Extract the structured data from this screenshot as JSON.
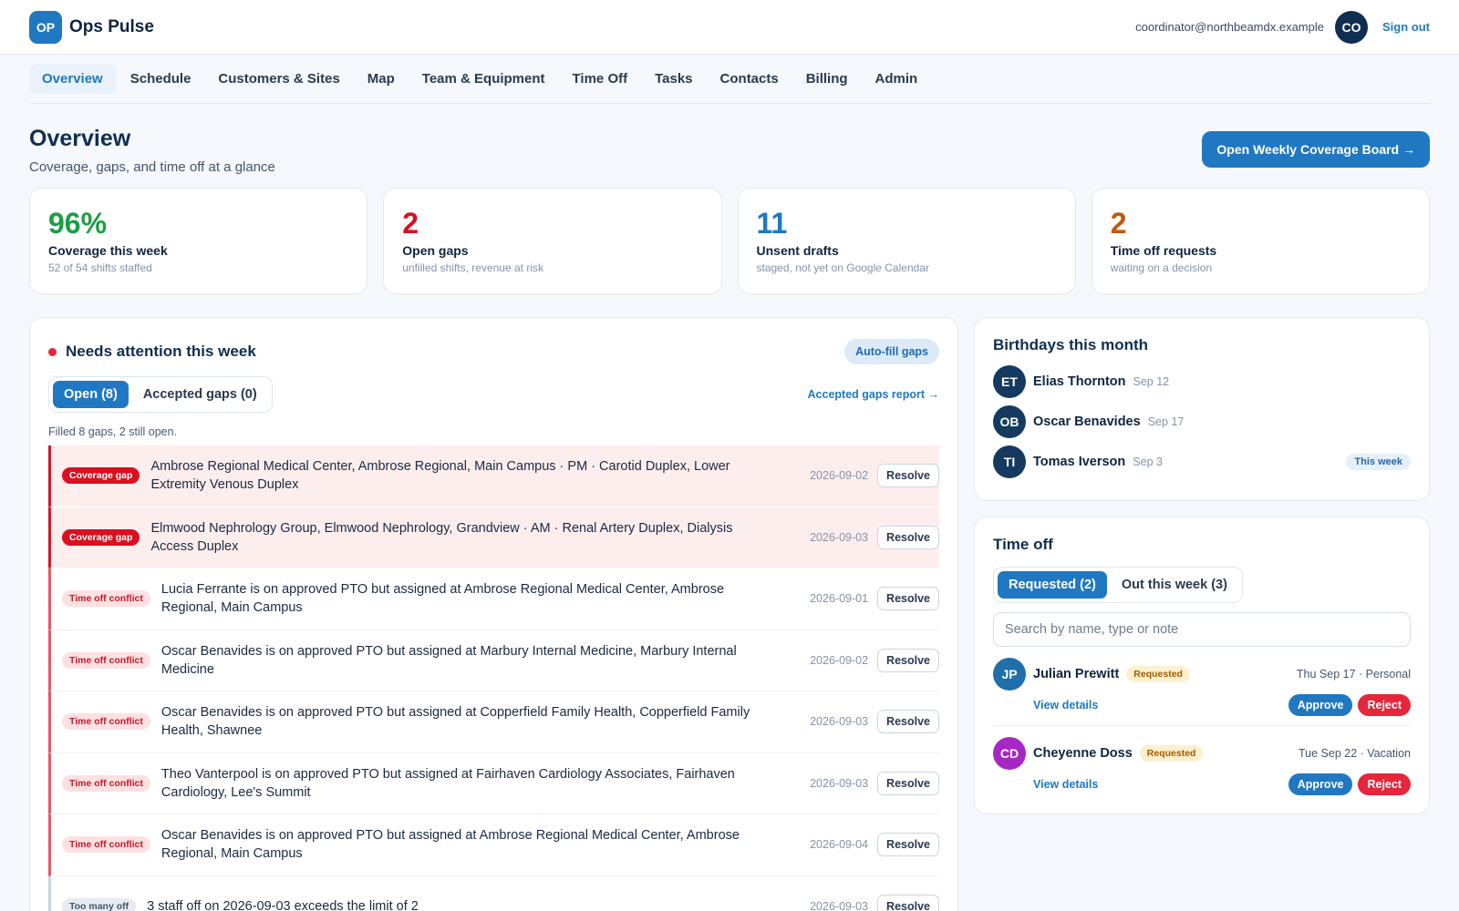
{
  "brand": {
    "initials": "OP",
    "name": "Ops Pulse"
  },
  "user": {
    "email": "coordinator@northbeamdx.example",
    "initials": "CO",
    "signout": "Sign out"
  },
  "nav": [
    "Overview",
    "Schedule",
    "Customers & Sites",
    "Map",
    "Team & Equipment",
    "Time Off",
    "Tasks",
    "Contacts",
    "Billing",
    "Admin"
  ],
  "nav_active": "Overview",
  "page": {
    "title": "Overview",
    "subtitle": "Coverage, gaps, and time off at a glance",
    "primary_button": "Open Weekly Coverage Board →"
  },
  "colors": {
    "accent": "#1f78c1",
    "kpi_coverage": "#1a9e44",
    "kpi_gaps": "#d9101f",
    "kpi_drafts": "#1f78c1",
    "kpi_timeoff": "#c2570f"
  },
  "kpis": [
    {
      "value": "96%",
      "label": "Coverage this week",
      "sub": "52 of 54 shifts staffed",
      "color": "#1a9e44"
    },
    {
      "value": "2",
      "label": "Open gaps",
      "sub": "unfilled shifts, revenue at risk",
      "color": "#d9101f"
    },
    {
      "value": "11",
      "label": "Unsent drafts",
      "sub": "staged, not yet on Google Calendar",
      "color": "#1f78c1"
    },
    {
      "value": "2",
      "label": "Time off requests",
      "sub": "waiting on a decision",
      "color": "#c2570f"
    }
  ],
  "attention": {
    "title": "Needs attention this week",
    "autofill": "Auto-fill gaps",
    "tabs": [
      "Open (8)",
      "Accepted gaps (0)"
    ],
    "report_link": "Accepted gaps report →",
    "note": "Filled 8 gaps, 2 still open.",
    "resolve_label": "Resolve",
    "items": [
      {
        "type": "gap",
        "badge": "Coverage gap",
        "text": "Ambrose Regional Medical Center, Ambrose Regional, Main Campus · PM · Carotid Duplex, Lower Extremity Venous Duplex",
        "date": "2026-09-02"
      },
      {
        "type": "gap",
        "badge": "Coverage gap",
        "text": "Elmwood Nephrology Group, Elmwood Nephrology, Grandview · AM · Renal Artery Duplex, Dialysis Access Duplex",
        "date": "2026-09-03"
      },
      {
        "type": "conflict",
        "badge": "Time off conflict",
        "text": "Lucia Ferrante is on approved PTO but assigned at Ambrose Regional Medical Center, Ambrose Regional, Main Campus",
        "date": "2026-09-01"
      },
      {
        "type": "conflict",
        "badge": "Time off conflict",
        "text": "Oscar Benavides is on approved PTO but assigned at Marbury Internal Medicine, Marbury Internal Medicine",
        "date": "2026-09-02"
      },
      {
        "type": "conflict",
        "badge": "Time off conflict",
        "text": "Oscar Benavides is on approved PTO but assigned at Copperfield Family Health, Copperfield Family Health, Shawnee",
        "date": "2026-09-03"
      },
      {
        "type": "conflict",
        "badge": "Time off conflict",
        "text": "Theo Vanterpool is on approved PTO but assigned at Fairhaven Cardiology Associates, Fairhaven Cardiology, Lee's Summit",
        "date": "2026-09-03"
      },
      {
        "type": "conflict",
        "badge": "Time off conflict",
        "text": "Oscar Benavides is on approved PTO but assigned at Ambrose Regional Medical Center, Ambrose Regional, Main Campus",
        "date": "2026-09-04"
      },
      {
        "type": "toomany",
        "badge": "Too many off",
        "text": "3 staff off on 2026-09-03 exceeds the limit of 2",
        "date": "2026-09-03"
      }
    ]
  },
  "birthdays": {
    "title": "Birthdays this month",
    "items": [
      {
        "initials": "ET",
        "name": "Elias Thornton",
        "date": "Sep 12",
        "tag": ""
      },
      {
        "initials": "OB",
        "name": "Oscar Benavides",
        "date": "Sep 17",
        "tag": ""
      },
      {
        "initials": "TI",
        "name": "Tomas Iverson",
        "date": "Sep 3",
        "tag": "This week"
      }
    ]
  },
  "timeoff": {
    "title": "Time off",
    "tabs": [
      "Requested (2)",
      "Out this week (3)"
    ],
    "search_placeholder": "Search by name, type or note",
    "view_label": "View details",
    "approve_label": "Approve",
    "reject_label": "Reject",
    "requests": [
      {
        "initials": "JP",
        "name": "Julian Prewitt",
        "status": "Requested",
        "when": "Thu Sep 17 · Personal",
        "avatar_color": "blue"
      },
      {
        "initials": "CD",
        "name": "Cheyenne Doss",
        "status": "Requested",
        "when": "Tue Sep 22 · Vacation",
        "avatar_color": "purple"
      }
    ]
  }
}
